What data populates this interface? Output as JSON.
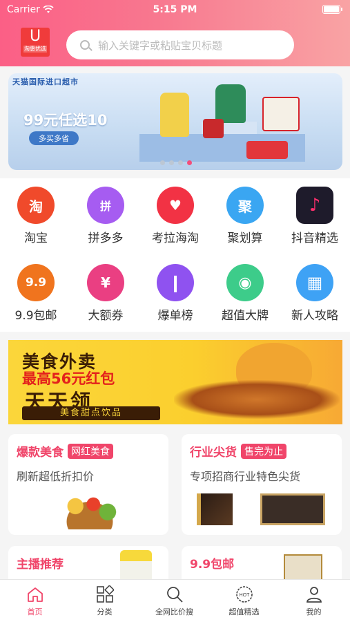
{
  "status_bar": {
    "carrier": "Carrier",
    "time": "5:15 PM"
  },
  "header": {
    "logo_letter": "U",
    "logo_caption": "淘惠优选",
    "search_placeholder": "输入关键字或粘贴宝贝标题"
  },
  "banner": {
    "tagline": "天猫国际进口超市",
    "headline": "99元任选10",
    "button": "多买多省",
    "slides": 4,
    "active_slide": 4
  },
  "grid": {
    "items": [
      {
        "label": "淘宝",
        "glyph": "淘",
        "color": "#f04a2b"
      },
      {
        "label": "拼多多",
        "glyph": "拼",
        "color": "#a65cf1"
      },
      {
        "label": "考拉海淘",
        "glyph": "♥",
        "color": "#f23244"
      },
      {
        "label": "聚划算",
        "glyph": "聚",
        "color": "#3aa6f2"
      },
      {
        "label": "抖音精选",
        "glyph": "♪",
        "color": "#1e1b2b"
      },
      {
        "label": "9.9包邮",
        "glyph": "9.9",
        "color": "#f0741e"
      },
      {
        "label": "大额券",
        "glyph": "¥",
        "color": "#ea3f82"
      },
      {
        "label": "爆单榜",
        "glyph": "❙",
        "color": "#8f52f0"
      },
      {
        "label": "超值大牌",
        "glyph": "◉",
        "color": "#3dcc8a"
      },
      {
        "label": "新人攻略",
        "glyph": "▦",
        "color": "#3ea2f5"
      }
    ]
  },
  "food_banner": {
    "line1": "美食外卖",
    "line2": "最高56元红包",
    "line3": "天天领",
    "line4": "美食甜点饮品"
  },
  "cards": [
    {
      "title": "爆款美食",
      "tag": "网红美食",
      "subtitle": "刷新超低折扣价"
    },
    {
      "title": "行业尖货",
      "tag": "售完为止",
      "subtitle": "专项招商行业特色尖货"
    },
    {
      "title": "主播推荐",
      "tag": "",
      "subtitle": ""
    },
    {
      "title": "9.9包邮",
      "tag": "",
      "subtitle": ""
    }
  ],
  "tabbar": {
    "items": [
      {
        "label": "首页",
        "icon": "home-icon",
        "active": true
      },
      {
        "label": "分类",
        "icon": "category-icon",
        "active": false
      },
      {
        "label": "全网比价搜",
        "icon": "search-icon",
        "active": false
      },
      {
        "label": "超值精选",
        "icon": "hot-icon",
        "active": false
      },
      {
        "label": "我的",
        "icon": "user-icon",
        "active": false
      }
    ]
  },
  "colors": {
    "accent": "#f0456a",
    "header_start": "#fb5f86",
    "header_end": "#f9a3a4"
  }
}
